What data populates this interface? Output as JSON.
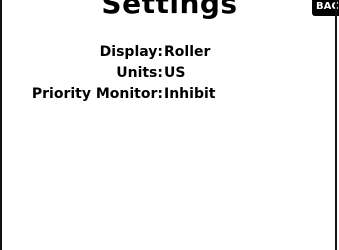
{
  "header": {
    "title": "Settings",
    "back_label": "BAC"
  },
  "settings": [
    {
      "label": "Display:",
      "value": "Roller"
    },
    {
      "label": "Units:",
      "value": "US"
    },
    {
      "label": "Priority Monitor:",
      "value": "Inhibit"
    }
  ]
}
